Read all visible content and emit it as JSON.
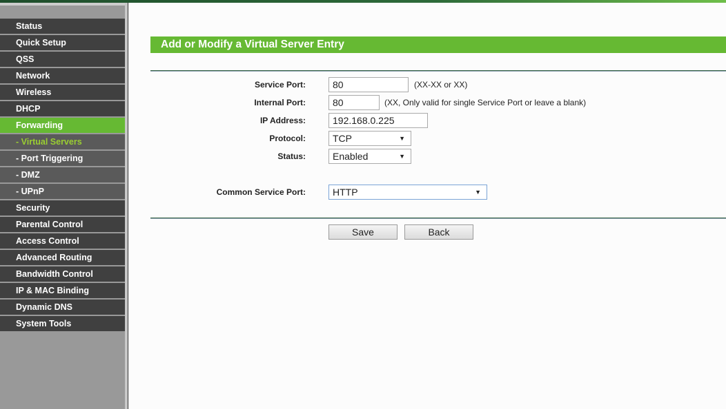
{
  "sidebar": {
    "items": [
      {
        "label": "Status"
      },
      {
        "label": "Quick Setup"
      },
      {
        "label": "QSS"
      },
      {
        "label": "Network"
      },
      {
        "label": "Wireless"
      },
      {
        "label": "DHCP"
      },
      {
        "label": "Forwarding"
      },
      {
        "label": "- Virtual Servers"
      },
      {
        "label": "- Port Triggering"
      },
      {
        "label": "- DMZ"
      },
      {
        "label": "- UPnP"
      },
      {
        "label": "Security"
      },
      {
        "label": "Parental Control"
      },
      {
        "label": "Access Control"
      },
      {
        "label": "Advanced Routing"
      },
      {
        "label": "Bandwidth Control"
      },
      {
        "label": "IP & MAC Binding"
      },
      {
        "label": "Dynamic DNS"
      },
      {
        "label": "System Tools"
      }
    ]
  },
  "form": {
    "title": "Add or Modify a Virtual Server Entry",
    "service_port": {
      "label": "Service Port:",
      "value": "80",
      "hint": "(XX-XX or XX)"
    },
    "internal_port": {
      "label": "Internal Port:",
      "value": "80",
      "hint": "(XX, Only valid for single Service Port or leave a blank)"
    },
    "ip_address": {
      "label": "IP Address:",
      "value": "192.168.0.225"
    },
    "protocol": {
      "label": "Protocol:",
      "value": "TCP"
    },
    "status": {
      "label": "Status:",
      "value": "Enabled"
    },
    "common_service_port": {
      "label": "Common Service Port:",
      "value": "HTTP"
    },
    "save": "Save",
    "back": "Back"
  }
}
